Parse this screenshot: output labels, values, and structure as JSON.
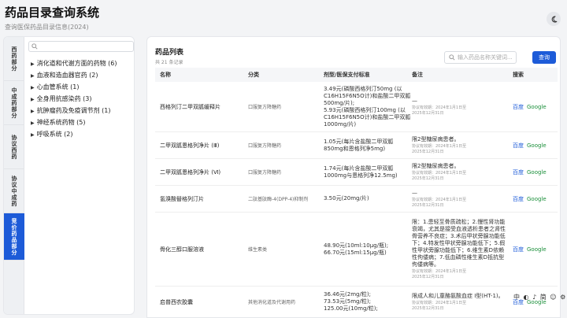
{
  "header": {
    "title": "药品目录查询系统",
    "subtitle": "查询医保药品目录信息(2024)"
  },
  "sidebar": {
    "tabs": [
      {
        "label": "西药部分",
        "active": false
      },
      {
        "label": "中成药部分",
        "active": false
      },
      {
        "label": "协议西药",
        "active": false
      },
      {
        "label": "协议中成药",
        "active": false
      },
      {
        "label": "竞价药品部分",
        "active": true
      }
    ],
    "search_placeholder": "",
    "tree": [
      "消化道和代谢方面的药物 (6)",
      "血液和造血器官药 (2)",
      "心血管系统 (1)",
      "全身用抗感染药 (3)",
      "抗肿瘤药及免疫调节剂 (1)",
      "神经系统药物 (5)",
      "呼吸系统 (2)"
    ]
  },
  "main": {
    "title": "药品列表",
    "count": "共 21 条记录",
    "search_placeholder": "输入药品名称关键词...",
    "search_button": "查询",
    "columns": [
      "名称",
      "分类",
      "剂型/医保支付标准",
      "备注",
      "搜索"
    ],
    "rows": [
      {
        "name": "西格列汀二甲双胍缓释片",
        "category": "口服复方降糖药",
        "price": [
          "3.49元(磷酸西格列汀50mg (以C16H15F6N5O计)和盐酸二甲双胍500mg/片);",
          "5.93元(磷酸西格列汀100mg (以C16H15F6N5O计)和盐酸二甲双胍1000mg/片)"
        ],
        "note": [
          "—"
        ],
        "meta": [
          "协议有效期：2024年1月1日至",
          "2025年12月31日"
        ],
        "h": 64
      },
      {
        "name": "二甲双胍恩格列净片 (Ⅲ)",
        "category": "口服复方降糖药",
        "price": [
          "1.05元(每片含盐酸二甲双胍850mg和恩格列净5mg)"
        ],
        "note": [
          "限2型糖尿病患者。"
        ],
        "meta": [
          "协议有效期：2024年1月1日至",
          "2025年12月31日"
        ],
        "h": 34
      },
      {
        "name": "二甲双胍恩格列净片 (Ⅵ)",
        "category": "口服复方降糖药",
        "price": [
          "1.74元(每片含盐酸二甲双胍1000mg与恩格列净12.5mg)"
        ],
        "note": [
          "限2型糖尿病患者。"
        ],
        "meta": [
          "协议有效期：2024年1月1日至",
          "2025年12月31日"
        ],
        "h": 34
      },
      {
        "name": "氢溴酸替格列汀片",
        "category": "二肽基肽酶-4(DPP-4)抑制剂",
        "price": [
          "3.50元(20mg/片)"
        ],
        "note": [
          "—"
        ],
        "meta": [
          "协议有效期：2024年1月1日至",
          "2025年12月31日"
        ],
        "h": 34
      },
      {
        "name": "骨化三醇口服溶液",
        "category": "维生素类",
        "price": [
          "48.90元(10ml:10μg/瓶);",
          "66.70元(15ml:15μg/瓶)"
        ],
        "note": [
          "限：1.患轻至骨质疏松；2.慢性肾功能衰竭，尤其是接受血液透析患者之肾性骨营养不良症；3.术后甲状旁腺功能低下；4.特发性甲状旁腺功能低下；5.假性甲状旁腺功能低下；6.维生素D依赖性佝偻病；7.低血磷性维生素D抵抗型佝偻病等。"
        ],
        "meta": [
          "协议有效期：2024年1月1日至",
          "2025年12月31日"
        ],
        "h": 94
      },
      {
        "name": "启普西农胶囊",
        "category": "其他消化道及代谢用药",
        "price": [
          "36.46元(2mg/粒);",
          "73.53元(5mg/粒);",
          "125.00元(10mg/粒);"
        ],
        "note": [
          "限成人和儿童酪氨酸血症 Ⅰ型(HT-1)。"
        ],
        "meta": [
          "协议有效期：2024年1月1日至",
          "2025年12月31日"
        ],
        "h": 40
      }
    ],
    "link_baidu": "百度",
    "link_google": "Google"
  },
  "ime": "中 ◐ ♪ 简 ☺ ⚙ ⊞ ⋮",
  "colors": {
    "accent": "#1d5bd8",
    "google_link": "#1a8f3a"
  }
}
